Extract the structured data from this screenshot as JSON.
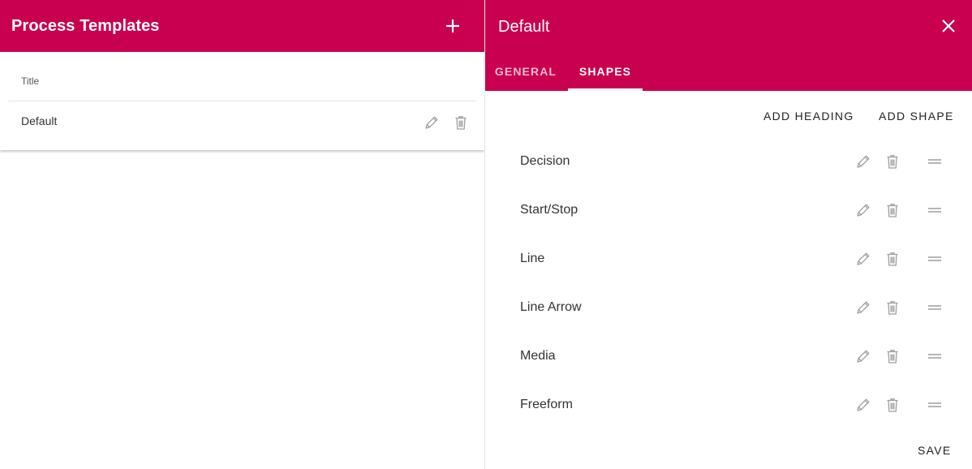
{
  "colors": {
    "brand": "#c9004f",
    "header_text": "#ffffff",
    "icon_gray": "#9e9e9e"
  },
  "left_pane": {
    "title": "Process Templates",
    "add_icon": "plus-icon",
    "table": {
      "column_header": "Title",
      "rows": [
        {
          "title": "Default",
          "edit_icon": "pencil-icon",
          "delete_icon": "trash-icon"
        }
      ]
    }
  },
  "right_pane": {
    "title": "Default",
    "close_icon": "close-icon",
    "tabs": [
      {
        "label": "GENERAL",
        "active": false
      },
      {
        "label": "SHAPES",
        "active": true
      }
    ],
    "actions": {
      "add_heading": "ADD HEADING",
      "add_shape": "ADD SHAPE"
    },
    "shapes": [
      {
        "label": "Decision"
      },
      {
        "label": "Start/Stop"
      },
      {
        "label": "Line"
      },
      {
        "label": "Line Arrow"
      },
      {
        "label": "Media"
      },
      {
        "label": "Freeform"
      }
    ],
    "row_icons": {
      "edit": "pencil-icon",
      "delete": "trash-icon",
      "drag": "drag-handle-icon"
    },
    "save_label": "SAVE"
  }
}
